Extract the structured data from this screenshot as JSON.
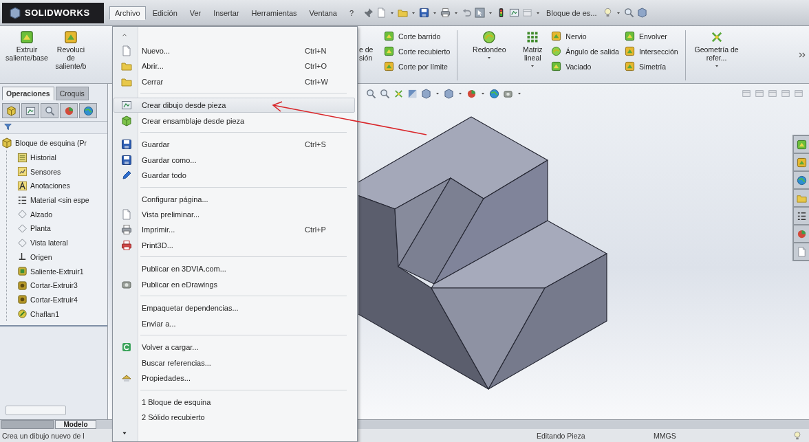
{
  "app": {
    "logo": "SOLIDWORKS"
  },
  "menubar": [
    {
      "label": "Archivo",
      "selected": true
    },
    {
      "label": "Edición",
      "selected": false
    },
    {
      "label": "Ver",
      "selected": false
    },
    {
      "label": "Insertar",
      "selected": false
    },
    {
      "label": "Herramientas",
      "selected": false
    },
    {
      "label": "Ventana",
      "selected": false
    },
    {
      "label": "?",
      "selected": false
    }
  ],
  "quick_toolbar": {
    "document": "Bloque de es..."
  },
  "ribbon": {
    "left_commands": [
      {
        "label": "Extruir saliente/base"
      },
      {
        "label": "Revoluci\nde\nsaliente/b"
      }
    ],
    "right_commands": [
      {
        "kind": "partial",
        "label": "e de\nsión"
      },
      {
        "kind": "stack",
        "items": [
          {
            "label": "Corte barrido"
          },
          {
            "label": "Corte recubierto"
          },
          {
            "label": "Corte por límite"
          }
        ]
      },
      {
        "kind": "separator"
      },
      {
        "kind": "large",
        "label": "Redondeo",
        "dropdown": true
      },
      {
        "kind": "large",
        "label": "Matriz lineal",
        "dropdown": true
      },
      {
        "kind": "stack",
        "items": [
          {
            "label": "Nervio"
          },
          {
            "label": "Ángulo de salida"
          },
          {
            "label": "Vaciado"
          }
        ]
      },
      {
        "kind": "stack",
        "items": [
          {
            "label": "Envolver"
          },
          {
            "label": "Intersección"
          },
          {
            "label": "Simetría"
          }
        ]
      },
      {
        "kind": "separator"
      },
      {
        "kind": "large",
        "label": "Geometría de refer...",
        "dropdown": true
      },
      {
        "kind": "more"
      }
    ]
  },
  "feature_manager": {
    "tabs": [
      {
        "label": "Operaciones",
        "selected": true
      },
      {
        "label": "Croquis",
        "selected": false
      }
    ],
    "tree": {
      "label": "Bloque de esquina  (Pr",
      "children": [
        {
          "label": "Historial"
        },
        {
          "label": "Sensores"
        },
        {
          "label": "Anotaciones"
        },
        {
          "label": "Material <sin espe"
        },
        {
          "label": "Alzado"
        },
        {
          "label": "Planta"
        },
        {
          "label": "Vista lateral"
        },
        {
          "label": "Origen"
        },
        {
          "label": "Saliente-Extruir1"
        },
        {
          "label": "Cortar-Extruir3"
        },
        {
          "label": "Cortar-Extruir4"
        },
        {
          "label": "Chaflan1"
        }
      ]
    },
    "bottom_tabs": [
      {
        "selected": false
      },
      {
        "label": "Modelo",
        "selected": true
      }
    ]
  },
  "file_menu": {
    "groups": [
      [
        {
          "label": "Nuevo...",
          "shortcut": "Ctrl+N",
          "selected": false
        },
        {
          "label": "Abrir...",
          "shortcut": "Ctrl+O",
          "selected": false
        },
        {
          "label": "Cerrar",
          "shortcut": "Ctrl+W",
          "selected": false
        }
      ],
      [
        {
          "label": "Crear dibujo desde pieza",
          "selected": true
        },
        {
          "label": "Crear ensamblaje desde pieza",
          "selected": false
        }
      ],
      [
        {
          "label": "Guardar",
          "shortcut": "Ctrl+S",
          "selected": false
        },
        {
          "label": "Guardar como...",
          "selected": false
        },
        {
          "label": "Guardar todo",
          "selected": false
        }
      ],
      [
        {
          "label": "Configurar página...",
          "selected": false
        },
        {
          "label": "Vista preliminar...",
          "selected": false
        },
        {
          "label": "Imprimir...",
          "shortcut": "Ctrl+P",
          "selected": false
        },
        {
          "label": "Print3D...",
          "selected": false
        }
      ],
      [
        {
          "label": "Publicar en 3DVIA.com...",
          "selected": false
        },
        {
          "label": "Publicar en eDrawings",
          "selected": false
        }
      ],
      [
        {
          "label": "Empaquetar dependencias...",
          "selected": false
        },
        {
          "label": "Enviar a...",
          "selected": false
        }
      ],
      [
        {
          "label": "Volver a cargar...",
          "selected": false
        },
        {
          "label": "Buscar referencias...",
          "selected": false
        },
        {
          "label": "Propiedades...",
          "selected": false
        }
      ],
      [
        {
          "label": "1 Bloque de esquina",
          "selected": false
        },
        {
          "label": "2 Sólido recubierto",
          "selected": false
        }
      ]
    ]
  },
  "status_bar": {
    "message": "Crea un dibujo nuevo de l",
    "mode": "Editando Pieza",
    "units": "MMGS"
  }
}
